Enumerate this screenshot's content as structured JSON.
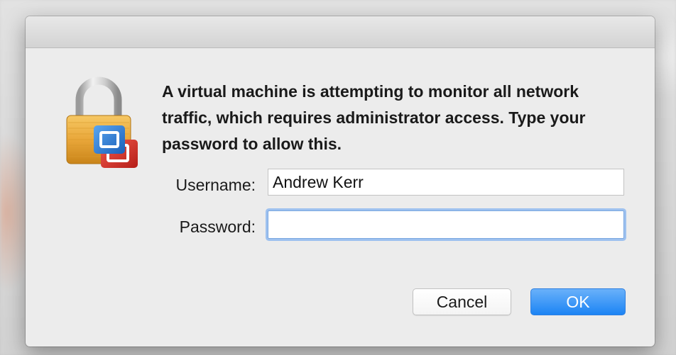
{
  "dialog": {
    "icon": "padlock-with-vmware-badge-icon",
    "message": "A virtual machine is attempting to monitor all network traffic, which requires administrator access. Type your password to allow this.",
    "username_label": "Username:",
    "username_value": "Andrew Kerr",
    "password_label": "Password:",
    "password_value": "",
    "cancel_label": "Cancel",
    "ok_label": "OK"
  },
  "colors": {
    "accent": "#1c84f4",
    "focus_ring": "#9ec1ef",
    "dialog_bg": "#ececec"
  }
}
